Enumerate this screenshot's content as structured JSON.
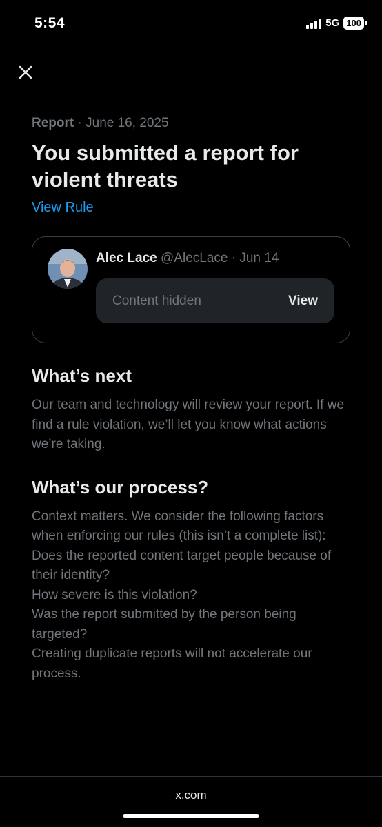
{
  "status_bar": {
    "time": "5:54",
    "network": "5G",
    "battery": "100"
  },
  "icons": {
    "close": "close-icon",
    "signal": "signal-icon",
    "battery": "battery-icon"
  },
  "report": {
    "label": "Report",
    "separator": "·",
    "date": "June 16, 2025",
    "title": "You submitted a report for violent threats",
    "view_rule_label": "View Rule"
  },
  "tweet": {
    "name": "Alec Lace",
    "handle": "@AlecLace",
    "separator": "·",
    "date": "Jun 14",
    "hidden_text": "Content hidden",
    "view_label": "View"
  },
  "whats_next": {
    "heading": "What’s next",
    "body": "Our team and technology will review your report. If we find a rule violation, we’ll let you know what actions we’re taking."
  },
  "process": {
    "heading": "What’s our process?",
    "paragraphs": [
      "Context matters. We consider the following factors when enforcing our rules (this isn’t a complete list):",
      "Does the reported content target people because of their identity?",
      "How severe is this violation?",
      "Was the report submitted by the person being targeted?",
      "Creating duplicate reports will not accelerate our process."
    ]
  },
  "footer": {
    "url": "x.com"
  },
  "colors": {
    "background": "#000000",
    "primary_text": "#e7e9ea",
    "secondary_text": "#71767b",
    "link": "#1d9bf0",
    "card_border": "#3b4046",
    "hidden_box": "#202327"
  }
}
